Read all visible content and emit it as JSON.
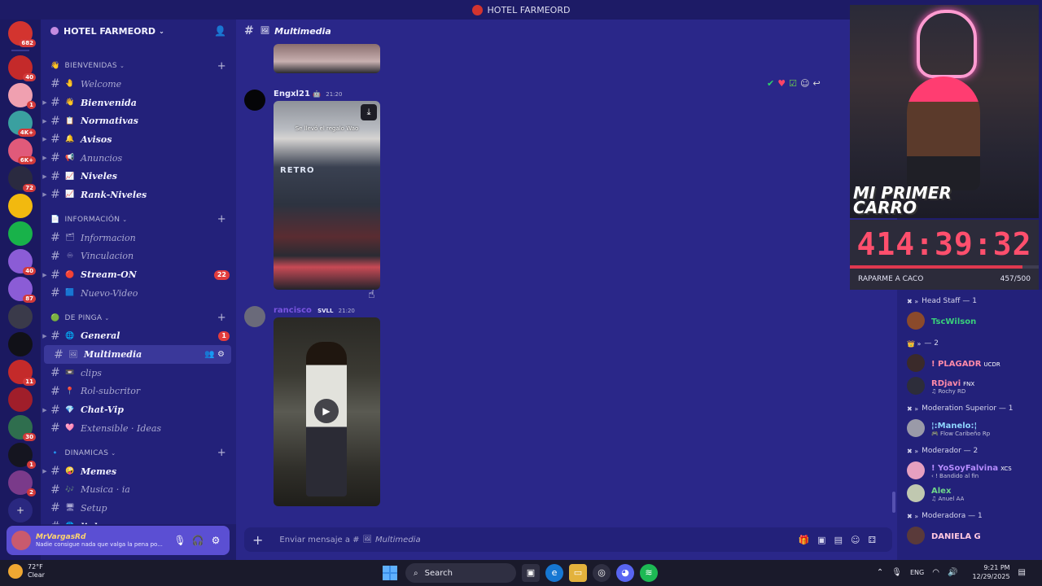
{
  "window": {
    "title": "HOTEL FARMEORD"
  },
  "servers": [
    {
      "badge": "682",
      "color": "#d3342f"
    },
    {
      "badge": "40",
      "color": "#c42a2a"
    },
    {
      "badge": "1",
      "color": "#f0a0b0"
    },
    {
      "badge": "4K+",
      "color": "#3aa0a0"
    },
    {
      "badge": "6K+",
      "color": "#e05a7a"
    },
    {
      "badge": "72",
      "color": "#2a2a40"
    },
    {
      "badge": "",
      "color": "#f2b90f"
    },
    {
      "badge": "",
      "color": "#18b24a"
    },
    {
      "badge": "40",
      "color": "#8b5cd6"
    },
    {
      "badge": "87",
      "color": "#8b5cd6"
    },
    {
      "badge": "",
      "color": "#3a3a4a"
    },
    {
      "badge": "",
      "color": "#111118"
    },
    {
      "badge": "11",
      "color": "#c42a2a"
    },
    {
      "badge": "",
      "color": "#a01e2a"
    },
    {
      "badge": "30",
      "color": "#2f6e4e"
    },
    {
      "badge": "1",
      "color": "#151520"
    },
    {
      "badge": "2",
      "color": "#7a3a8a"
    }
  ],
  "guild": {
    "name": "HOTEL FARMEORD"
  },
  "categories": [
    {
      "name": "BIENVENIDAS",
      "icon": "👋",
      "channels": [
        {
          "name": "Welcome",
          "emoji": "🤚",
          "arrow": false,
          "bright": false,
          "badge": ""
        },
        {
          "name": "Bienvenida",
          "emoji": "👋",
          "arrow": true,
          "bright": true,
          "badge": ""
        },
        {
          "name": "Normativas",
          "emoji": "📋",
          "arrow": true,
          "bright": true,
          "badge": ""
        },
        {
          "name": "Avisos",
          "emoji": "🔔",
          "arrow": true,
          "bright": true,
          "badge": ""
        },
        {
          "name": "Anuncios",
          "emoji": "📢",
          "arrow": true,
          "bright": false,
          "badge": ""
        },
        {
          "name": "Niveles",
          "emoji": "📈",
          "arrow": true,
          "bright": true,
          "badge": ""
        },
        {
          "name": "Rank-Niveles",
          "emoji": "📈",
          "arrow": true,
          "bright": true,
          "badge": ""
        }
      ]
    },
    {
      "name": "INFORMACIÓN",
      "icon": "📄",
      "channels": [
        {
          "name": "Informacion",
          "emoji": "🗂",
          "arrow": false,
          "bright": false,
          "badge": ""
        },
        {
          "name": "Vinculacion",
          "emoji": "♾",
          "arrow": false,
          "bright": false,
          "badge": ""
        },
        {
          "name": "Stream-ON",
          "emoji": "🔴",
          "arrow": true,
          "bright": true,
          "badge": "22"
        },
        {
          "name": "Nuevo-Video",
          "emoji": "🟦",
          "arrow": false,
          "bright": false,
          "badge": ""
        }
      ]
    },
    {
      "name": "DE PINGA",
      "icon": "🟢",
      "channels": [
        {
          "name": "General",
          "emoji": "🌐",
          "arrow": true,
          "bright": true,
          "badge": "1"
        },
        {
          "name": "Multimedia",
          "emoji": "🖼",
          "arrow": false,
          "bright": true,
          "badge": "",
          "active": true
        },
        {
          "name": "clips",
          "emoji": "📼",
          "arrow": false,
          "bright": false,
          "badge": ""
        },
        {
          "name": "Rol-subcritor",
          "emoji": "📍",
          "arrow": false,
          "bright": false,
          "badge": ""
        },
        {
          "name": "Chat-Vip",
          "emoji": "💎",
          "arrow": true,
          "bright": true,
          "badge": ""
        },
        {
          "name": "Extensible · Ideas",
          "emoji": "🩷",
          "arrow": false,
          "bright": false,
          "badge": ""
        }
      ]
    },
    {
      "name": "DINAMICAS",
      "icon": "🔹",
      "channels": [
        {
          "name": "Memes",
          "emoji": "🤪",
          "arrow": true,
          "bright": true,
          "badge": ""
        },
        {
          "name": "Musica · ia",
          "emoji": "🎶",
          "arrow": false,
          "bright": false,
          "badge": ""
        },
        {
          "name": "Setup",
          "emoji": "🖥",
          "arrow": false,
          "bright": false,
          "badge": ""
        },
        {
          "name": "links",
          "emoji": "🌐",
          "arrow": true,
          "bright": true,
          "badge": ""
        }
      ]
    }
  ],
  "user": {
    "name": "MrVargasRd",
    "status": "Nadie consigue nada que valga la pena po..."
  },
  "channel": {
    "name": "Multimedia"
  },
  "messages": [
    {
      "author": "Engxl21",
      "time": "21:20",
      "caption": "Se llevó el regalo Wao",
      "sign": "RETRO",
      "tag": ""
    },
    {
      "author": "rancisco",
      "time": "21:20",
      "tag": "SVLL"
    }
  ],
  "composer": {
    "placeholder": "Enviar mensaje a #",
    "channel": "Multimedia"
  },
  "stream": {
    "sign_line1": "MI PRIMER",
    "sign_line2": "CARRO",
    "timer": "414:39:32",
    "goal_label": "RAPARME A CACO",
    "goal_count": "457/500",
    "goal_progress": 0.914
  },
  "members": {
    "roles": [
      {
        "name": "Head Staff — 1",
        "icon": "✖",
        "members": [
          {
            "name": "TscWilson",
            "sub": "",
            "tag": "",
            "color": "#39d07a",
            "avatar": "#8b4a2b"
          }
        ]
      },
      {
        "name": "— 2",
        "icon": "👑",
        "members": [
          {
            "name": "! PLAGADR",
            "sub": "",
            "tag": "UCDR",
            "color": "#ff8aa8",
            "avatar": "#3a2a2a"
          },
          {
            "name": "RDjavi",
            "sub": "♫ Rochy RD",
            "tag": "FNX",
            "color": "#ff8aa8",
            "avatar": "#2d2d3a"
          }
        ]
      },
      {
        "name": "Moderation Superior — 1",
        "icon": "✖",
        "members": [
          {
            "name": "¦:Manelo:¦",
            "sub": "🎮 Flow Caribeño Rp",
            "tag": "",
            "color": "#8fd6ff",
            "avatar": "#9a9aa8"
          }
        ]
      },
      {
        "name": "Moderador — 2",
        "icon": "✖",
        "members": [
          {
            "name": "! YoSoyFalvina",
            "sub": "‹ ! Bandido al fin",
            "tag": "XCS",
            "color": "#b68cff",
            "avatar": "#e6a0c0"
          },
          {
            "name": "Alex",
            "sub": "♫ Anuel AA",
            "tag": "",
            "color": "#6fd68a",
            "avatar": "#c0c8b0"
          }
        ]
      },
      {
        "name": "Moderadora — 1",
        "icon": "✖",
        "members": [
          {
            "name": "DANIELA G",
            "sub": "",
            "tag": "",
            "color": "#ffc8e0",
            "avatar": "#5a3a3a"
          }
        ]
      }
    ]
  },
  "taskbar": {
    "temp": "72°F",
    "weather": "Clear",
    "search": "Search",
    "lang": "ENG",
    "time": "9:21 PM",
    "date": "12/29/2025"
  }
}
